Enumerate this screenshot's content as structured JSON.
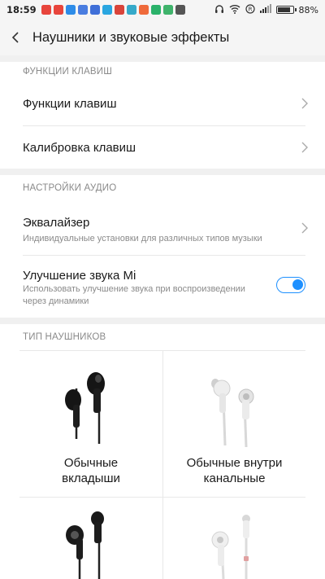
{
  "status_bar": {
    "time": "18:59",
    "battery": "88%",
    "battery_level": 0.88,
    "notification_icons": [
      {
        "name": "tiktok-icon",
        "color": "#e8453c"
      },
      {
        "name": "tiktok-icon-2",
        "color": "#e8453c"
      },
      {
        "name": "dropbox-icon",
        "color": "#2d8ce8"
      },
      {
        "name": "app-icon-blue",
        "color": "#4a7de0"
      },
      {
        "name": "app-icon-blue-2",
        "color": "#3f6fd8"
      },
      {
        "name": "shield-icon",
        "color": "#2aa6e0"
      },
      {
        "name": "gmail-icon",
        "color": "#d9443a"
      },
      {
        "name": "app-icon-teal",
        "color": "#36a9c9"
      },
      {
        "name": "photo-icon",
        "color": "#ef6a3b"
      },
      {
        "name": "app-icon-green",
        "color": "#2bb26a"
      },
      {
        "name": "play-store-icon",
        "color": "#3fb36b"
      },
      {
        "name": "more-icon",
        "color": "#555555"
      }
    ]
  },
  "header": {
    "title": "Наушники и звуковые эффекты"
  },
  "key_functions_section": {
    "header": "ФУНКЦИИ КЛАВИШ",
    "items": [
      {
        "label": "Функции клавиш"
      },
      {
        "label": "Калибровка клавиш"
      }
    ]
  },
  "audio_section": {
    "header": "НАСТРОЙКИ АУДИО",
    "equalizer": {
      "label": "Эквалайзер",
      "subtitle": "Индивидуальные установки для различных типов музыки"
    },
    "mi_sound": {
      "label": "Улучшение звука Mi",
      "subtitle_line1": "Использовать улучшение звука при воспроизведении",
      "subtitle_line2": "через динамики",
      "enabled": true
    }
  },
  "headphone_type_section": {
    "header": "ТИП НАУШНИКОВ",
    "types": [
      {
        "line1": "Обычные",
        "line2": "вкладыши"
      },
      {
        "line1": "Обычные внутри",
        "line2": "канальные"
      }
    ]
  },
  "colors": {
    "accent": "#1e90ff",
    "section_bg": "#f0f0f0"
  }
}
